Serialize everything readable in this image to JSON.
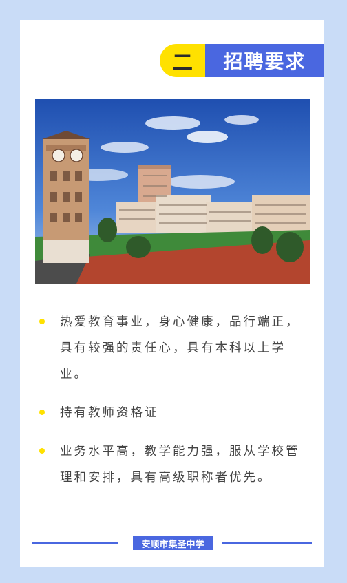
{
  "section": {
    "number": "二",
    "title": "招聘要求"
  },
  "requirements": [
    "热爱教育事业，身心健康，品行端正，具有较强的责任心，具有本科以上学业。",
    "持有教师资格证",
    "业务水平高，教学能力强，服从学校管理和安排，具有高级职称者优先。"
  ],
  "footer": {
    "school": "安顺市集圣中学"
  },
  "colors": {
    "background": "#c9dcf7",
    "accent_blue": "#4a67e0",
    "accent_yellow": "#ffe100"
  }
}
